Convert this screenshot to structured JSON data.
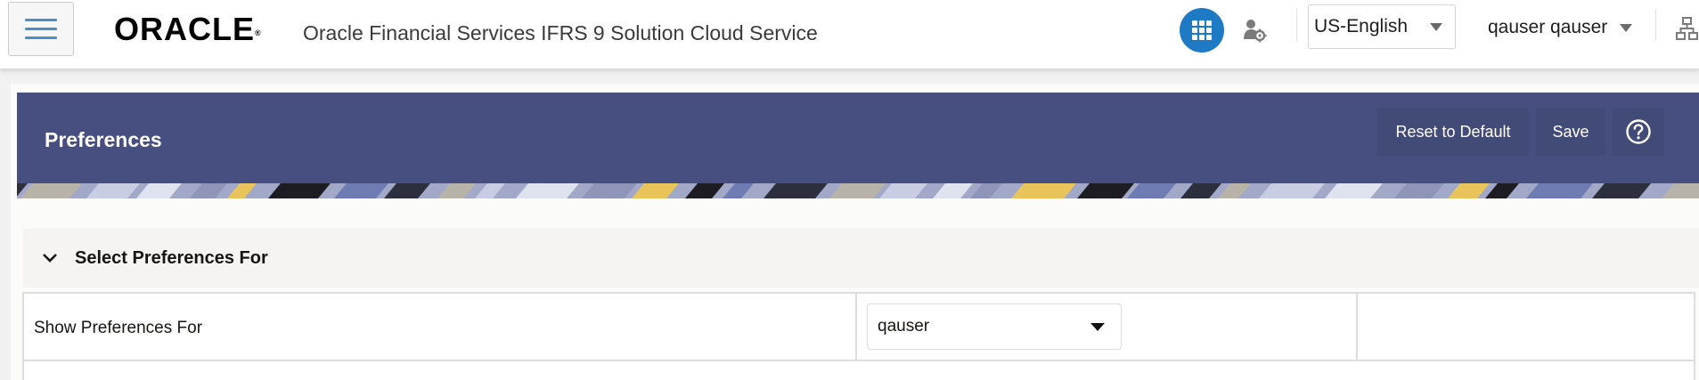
{
  "header": {
    "brand": "ORACLE",
    "brand_mark": "®",
    "app_title": "Oracle Financial Services IFRS 9 Solution Cloud Service",
    "language": "US-English",
    "user": "qauser qauser",
    "icons": {
      "menu": "hamburger-icon",
      "apps": "grid-apps-icon",
      "user_settings": "user-gear-icon",
      "hierarchy": "hierarchy-icon"
    }
  },
  "page": {
    "title": "Preferences",
    "buttons": {
      "reset": "Reset to Default",
      "save": "Save",
      "help": "help-icon"
    }
  },
  "section": {
    "title": "Select Preferences For",
    "rows": [
      {
        "label": "Show Preferences For",
        "value": "qauser"
      }
    ]
  },
  "colors": {
    "banner": "#474f80",
    "accent": "#1e7ac5",
    "menu_lines": "#4a8fc7"
  }
}
